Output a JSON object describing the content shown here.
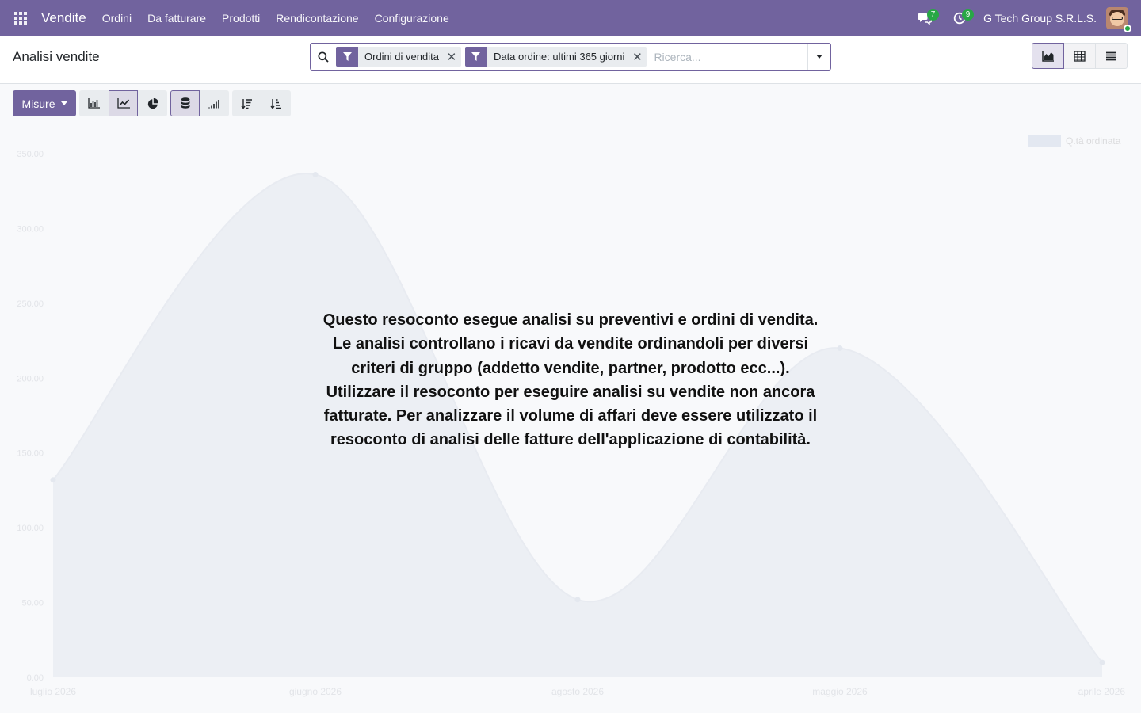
{
  "app": {
    "brand": "Vendite",
    "menu": [
      "Ordini",
      "Da fatturare",
      "Prodotti",
      "Rendicontazione",
      "Configurazione"
    ],
    "messages_count": "7",
    "activities_count": "9",
    "company": "G Tech Group S.R.L.S."
  },
  "control": {
    "title": "Analisi vendite",
    "facets": [
      {
        "label": "Ordini di vendita"
      },
      {
        "label": "Data ordine: ultimi 365 giorni"
      }
    ],
    "search_placeholder": "Ricerca..."
  },
  "toolbar": {
    "measures_label": "Misure"
  },
  "help_text": "Questo resoconto esegue analisi su preventivi e ordini di vendita. Le analisi controllano i ricavi da vendite ordinandoli per diversi criteri di gruppo (addetto vendite, partner, prodotto ecc...). Utilizzare il resoconto per eseguire analisi su vendite non ancora fatturate. Per analizzare il volume di affari deve essere utilizzato il resoconto di analisi delle fatture dell'applicazione di contabilità.",
  "colors": {
    "navbar": "#71639e",
    "accent": "#71639e",
    "badge": "#28a745"
  },
  "chart_data": {
    "type": "area",
    "categories": [
      "luglio 2026",
      "giugno 2026",
      "agosto 2026",
      "maggio 2026",
      "aprile 2026"
    ],
    "series": [
      {
        "name": "Q.tà ordinata",
        "values": [
          132,
          336,
          52,
          220,
          10
        ]
      }
    ],
    "y_ticks": [
      "0.00",
      "50.00",
      "100.00",
      "150.00",
      "200.00",
      "250.00",
      "300.00",
      "350.00"
    ],
    "ylim": [
      0,
      350
    ],
    "legend": "top-right",
    "faded": true
  }
}
